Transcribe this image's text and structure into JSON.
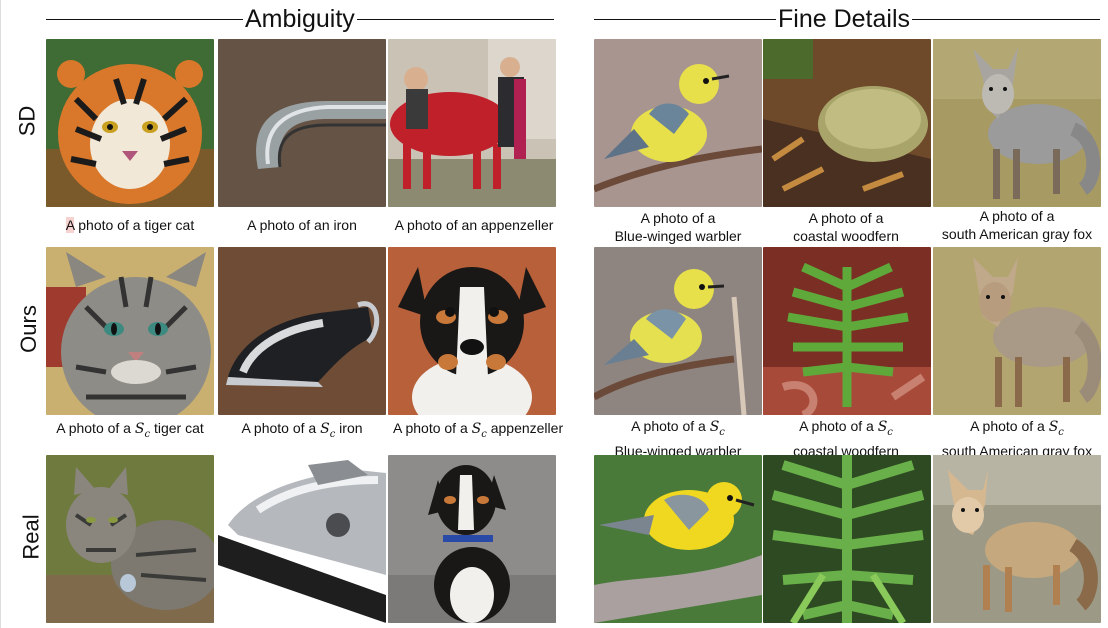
{
  "sections": {
    "ambiguity": "Ambiguity",
    "fine_details": "Fine Details"
  },
  "row_labels": {
    "sd": "SD",
    "ours": "Ours",
    "real": "Real"
  },
  "captions": {
    "sd": {
      "tiger_a": "A",
      "tiger_rest": " photo of a tiger cat",
      "iron": "A photo of an iron",
      "appenzeller": "A photo of an appenzeller",
      "warbler_1": "A photo of a",
      "warbler_2": "Blue-winged warbler",
      "woodfern_1": "A photo of a",
      "woodfern_2": "coastal woodfern",
      "fox_1": "A photo of a",
      "fox_2": "south American gray fox"
    },
    "ours": {
      "prefix": "A photo of a ",
      "token_s": "S",
      "token_c": "c",
      "tiger": " tiger cat",
      "iron": " iron",
      "appenzeller": " appenzeller",
      "warbler_2": "Blue-winged warbler",
      "woodfern_2": "coastal woodfern",
      "fox_2": "south American gray fox"
    }
  },
  "images": {
    "sd": [
      "tiger photo",
      "iron photo",
      "red horse photo",
      "warbler photo",
      "moss photo",
      "gray fox photo"
    ],
    "ours": [
      "tabby cat photo",
      "steam iron photo",
      "appenzeller dog photo",
      "warbler photo",
      "fern photo",
      "gray fox photo"
    ],
    "real": [
      "tabby cat photo",
      "steam iron photo",
      "appenzeller dog photo",
      "warbler photo",
      "fern photo",
      "gray fox photo"
    ]
  }
}
